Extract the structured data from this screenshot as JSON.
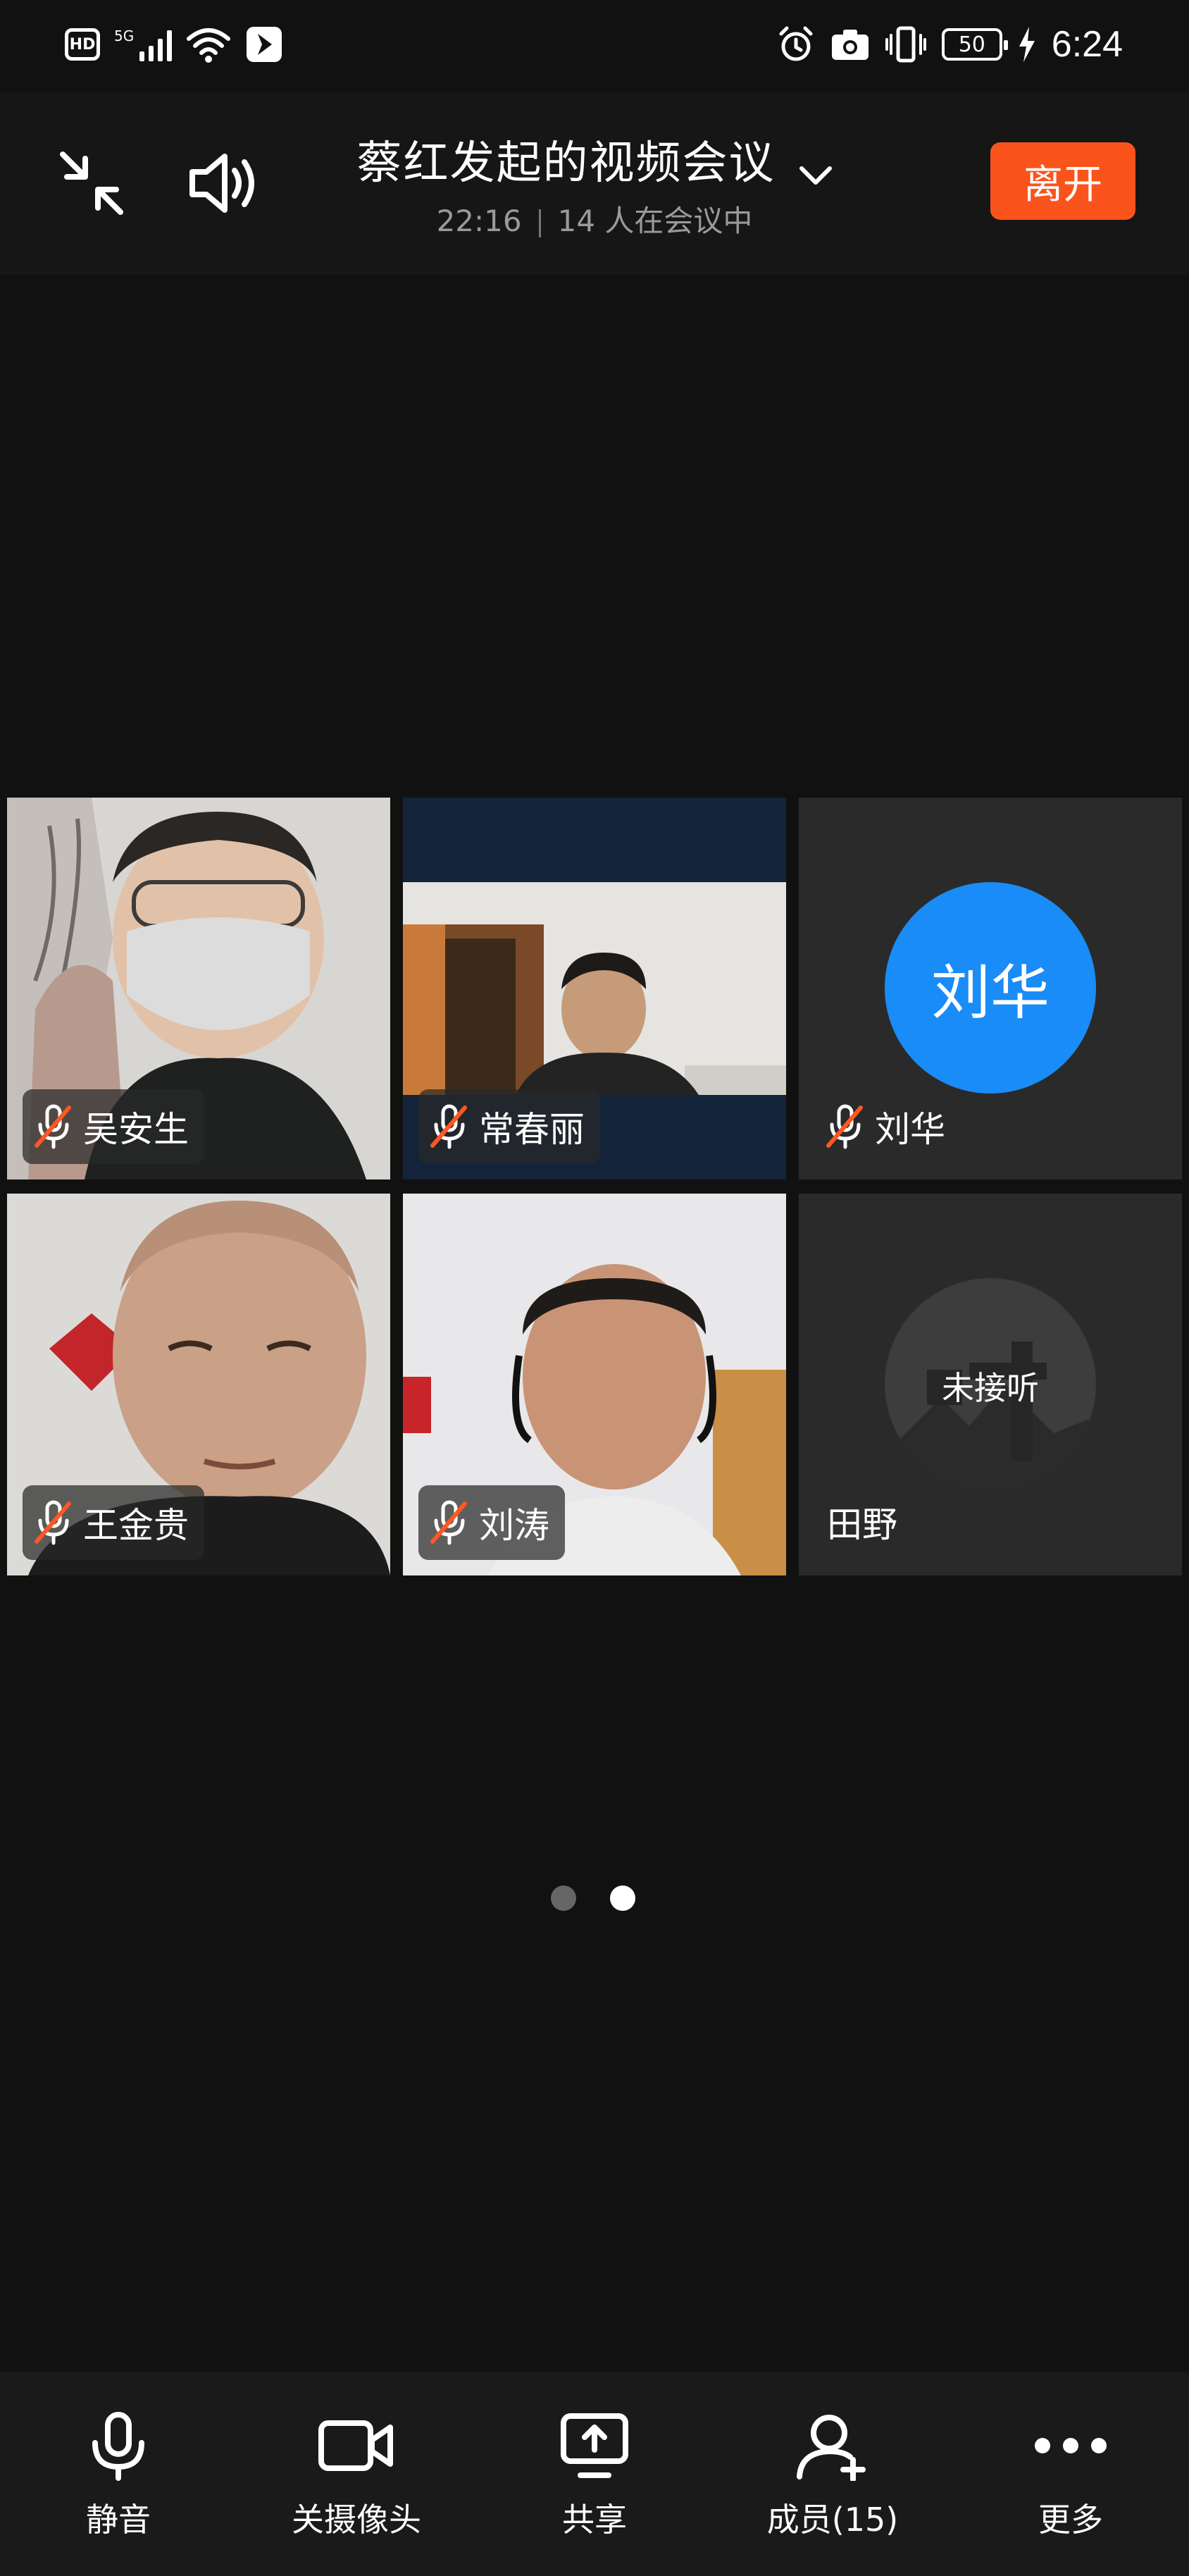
{
  "status_bar": {
    "hd_badge": "HD",
    "network": "5G",
    "battery": "50",
    "time": "6:24"
  },
  "header": {
    "title": "蔡红发起的视频会议",
    "duration": "22:16",
    "participants_text": "14 人在会议中",
    "leave_label": "离开"
  },
  "tiles": [
    {
      "name": "吴安生",
      "muted": true,
      "video": true
    },
    {
      "name": "常春丽",
      "muted": true,
      "video": true
    },
    {
      "name": "刘华",
      "muted": true,
      "video": false,
      "avatar_text": "刘华"
    },
    {
      "name": "王金贵",
      "muted": true,
      "video": true
    },
    {
      "name": "刘涛",
      "muted": true,
      "video": true
    },
    {
      "name": "田野",
      "muted": false,
      "video": false,
      "status": "未接听"
    }
  ],
  "pagination": {
    "pages": 2,
    "current": 2
  },
  "toolbar": {
    "mute": "静音",
    "camera": "关摄像头",
    "share": "共享",
    "members": "成员(15)",
    "more": "更多"
  },
  "colors": {
    "leave": "#fa541c",
    "avatar_blue": "#1a8cf7",
    "mute_slash": "#ff5722"
  }
}
